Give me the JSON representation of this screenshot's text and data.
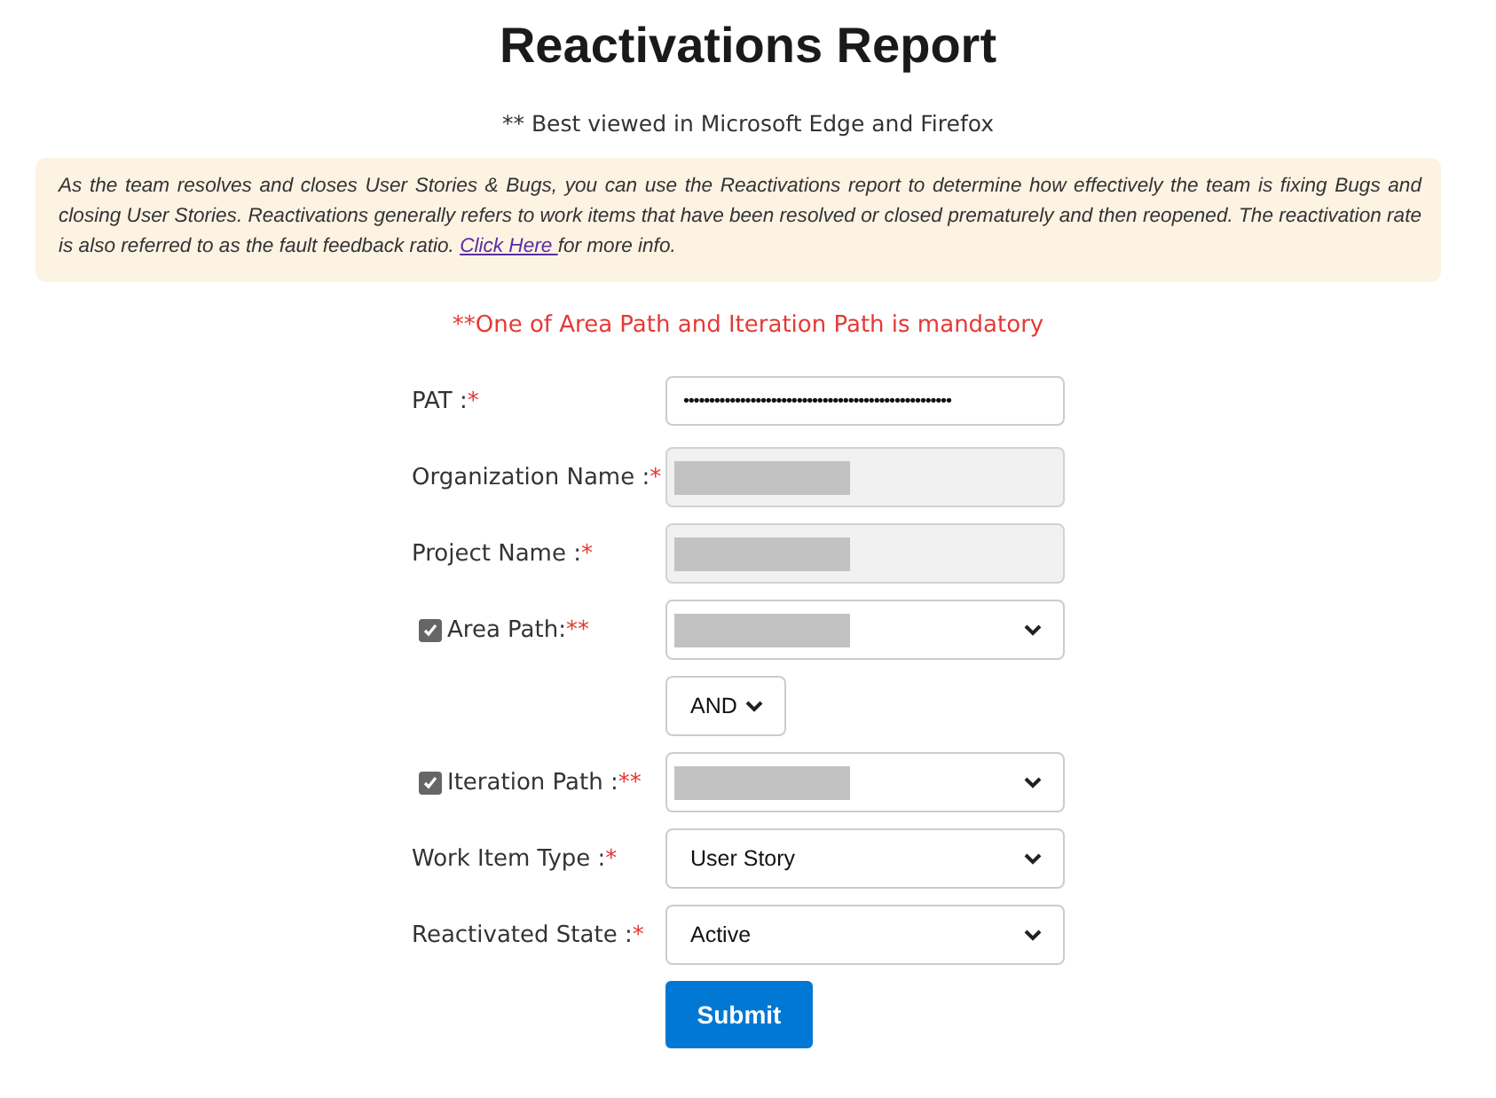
{
  "title": "Reactivations Report",
  "browser_note": "** Best viewed in Microsoft Edge and Firefox",
  "info": {
    "text": "As the team resolves and closes User Stories & Bugs, you can use the Reactivations report to determine how effectively the team is fixing Bugs and closing User Stories. Reactivations generally refers to work items that have been resolved or closed prematurely and then reopened. The reactivation rate is also referred to as the fault feedback ratio.",
    "link": "Click Here ",
    "after": "for more info."
  },
  "mandatory_note": "**One of Area Path and Iteration Path is mandatory",
  "fields": [
    {
      "kind": "password",
      "label": "PAT :",
      "required": "*",
      "value": "••••••••••••••••••••••••••••••••••••••••••••••••••••"
    },
    {
      "kind": "text",
      "label": "Organization Name :",
      "required": "*",
      "redacted": true,
      "disabled": true
    },
    {
      "kind": "text",
      "label": "Project Name :",
      "required": "*",
      "redacted": true,
      "disabled": true
    },
    {
      "kind": "select",
      "label": "Area Path:",
      "required": "**",
      "checked": true,
      "redacted": true
    },
    {
      "kind": "operator",
      "value": "AND"
    },
    {
      "kind": "select",
      "label": "Iteration Path :",
      "required": "**",
      "checked": true,
      "redacted": true
    },
    {
      "kind": "select",
      "label": "Work Item Type :",
      "required": "*",
      "value": "User Story"
    },
    {
      "kind": "select",
      "label": "Reactivated State :",
      "required": "*",
      "value": "Active"
    }
  ],
  "submit": "Submit"
}
